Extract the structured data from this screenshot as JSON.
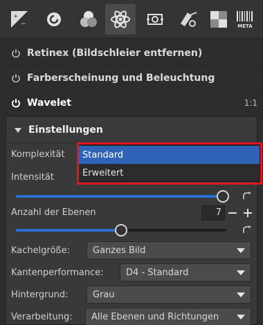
{
  "toolbar": {
    "tools": [
      {
        "name": "exposure-icon"
      },
      {
        "name": "details-icon"
      },
      {
        "name": "color-icon"
      },
      {
        "name": "advanced-icon",
        "active": true
      },
      {
        "name": "transform-icon"
      },
      {
        "name": "raw-icon"
      },
      {
        "name": "metadata-icon"
      }
    ],
    "meta_label": "META"
  },
  "modules": [
    {
      "title": "Retinex (Bildschleier entfernen)",
      "enabled": false
    },
    {
      "title": "Farberscheinung und Beleuchtung",
      "enabled": false
    },
    {
      "title": "Wavelet",
      "enabled": true,
      "ratio": "1:1"
    }
  ],
  "settings": {
    "title": "Einstellungen",
    "komplexitaet_label": "Komplexität",
    "intensitaet_label": "Intensität",
    "intensity_value": 0.985,
    "ebenen_label": "Anzahl der Ebenen",
    "ebenen_value": "7",
    "ebenen_slider": 0.5,
    "kachel_label": "Kachelgröße:",
    "kachel_value": "Ganzes Bild",
    "kanten_label": "Kantenperformance:",
    "kanten_value": "D4 - Standard",
    "hintergrund_label": "Hintergrund:",
    "hintergrund_value": "Grau",
    "verarbeitung_label": "Verarbeitung:",
    "verarbeitung_value": "Alle Ebenen und Richtungen"
  },
  "dropdown": {
    "options": [
      "Standard",
      "Erweitert"
    ],
    "selected": "Standard"
  },
  "colors": {
    "accent": "#2c6fd3",
    "highlight": "#e0161c"
  }
}
